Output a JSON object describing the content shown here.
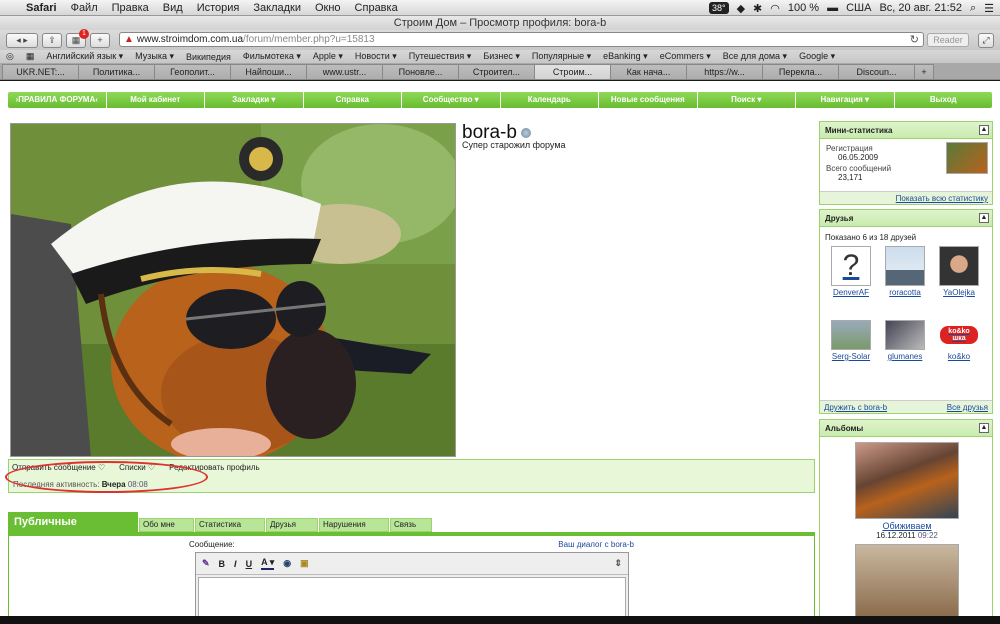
{
  "menubar": {
    "app": "Safari",
    "items": [
      "Файл",
      "Правка",
      "Вид",
      "История",
      "Закладки",
      "Окно",
      "Справка"
    ],
    "temp": "38°",
    "battery": "100 %",
    "locale": "США",
    "clock": "Вс, 20 авг.  21:52"
  },
  "window": {
    "title": "Строим Дом – Просмотр профиля: bora-b"
  },
  "toolbar": {
    "back_forward": "◂ ▸",
    "add": "+",
    "badge": "1",
    "url_host": "www.stroimdom.com.ua",
    "url_path": "/forum/member.php?u=15813",
    "reader": "Reader"
  },
  "bookmarks": [
    "Английский язык ▾",
    "Музыка ▾",
    "Википедия",
    "Фильмотека ▾",
    "Apple ▾",
    "Новости ▾",
    "Путешествия ▾",
    "Бизнес ▾",
    "Популярные ▾",
    "eBanking ▾",
    "eCommers ▾",
    "Все для дома ▾",
    "Google ▾"
  ],
  "tabs": [
    "UKR.NET:...",
    "Политика...",
    "Геополит...",
    "Найпоши...",
    "www.ustr...",
    "Поновле...",
    "Строител...",
    "Строим...",
    "Как нача...",
    "https://w...",
    "Перекла...",
    "Discoun..."
  ],
  "nav": [
    "›ПРАВИЛА ФОРУМА‹",
    "Мой кабинет",
    "Закладки ▾",
    "Справка",
    "Сообщество ▾",
    "Календарь",
    "Новые сообщения",
    "Поиск ▾",
    "Навигация ▾",
    "Выход"
  ],
  "profile": {
    "username": "bora-b",
    "usertitle": "Супер старожил форума",
    "actions": [
      "Отправить сообщение ♡",
      "Списки ♡",
      "Редактировать профиль"
    ],
    "last_activity_label": "Последняя активность:",
    "last_activity_day": "Вчера",
    "last_activity_time": "08:08"
  },
  "profile_tabs": [
    "Публичные сообщения",
    "Обо мне",
    "Статистика",
    "Друзья",
    "Нарушения",
    "Связь"
  ],
  "public_messages": {
    "message_label": "Сообщение:",
    "dialog_link": "Ваш диалог с bora-b",
    "editor_buttons": [
      "B",
      "I",
      "U",
      "A ▾"
    ]
  },
  "ministats": {
    "title": "Мини-статистика",
    "reg_label": "Регистрация",
    "reg_value": "06.05.2009",
    "posts_label": "Всего сообщений",
    "posts_value": "23,171",
    "show_all": "Показать всю статистику"
  },
  "friends": {
    "title": "Друзья",
    "summary": "Показано 6 из 18 друзей",
    "list": [
      "DenverAF",
      "roracotta",
      "YaOlejka",
      "Serg-Solar",
      "glumanes",
      "ko&ko"
    ],
    "friend_link": "Дружить с bora-b",
    "all_link": "Все друзья",
    "koko_logo": "ko&ko шка"
  },
  "albums": {
    "title": "Альбомы",
    "album_name": "Обиживаем",
    "album_date": "16.12.2011",
    "album_time": "09:22"
  }
}
